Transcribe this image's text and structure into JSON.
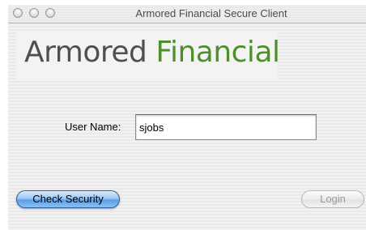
{
  "window": {
    "title": "Armored Financial Secure Client"
  },
  "logo": {
    "word1": "Armored",
    "word2": "Financial",
    "word1_color": "#4f4f4f",
    "word2_color": "#4f8f2a"
  },
  "login_form": {
    "username_label": "User Name:",
    "username_value": "sjobs"
  },
  "buttons": {
    "check_security_label": "Check Security",
    "login_label": "Login"
  },
  "colors": {
    "check_security_accent": "#5d9fe6"
  }
}
